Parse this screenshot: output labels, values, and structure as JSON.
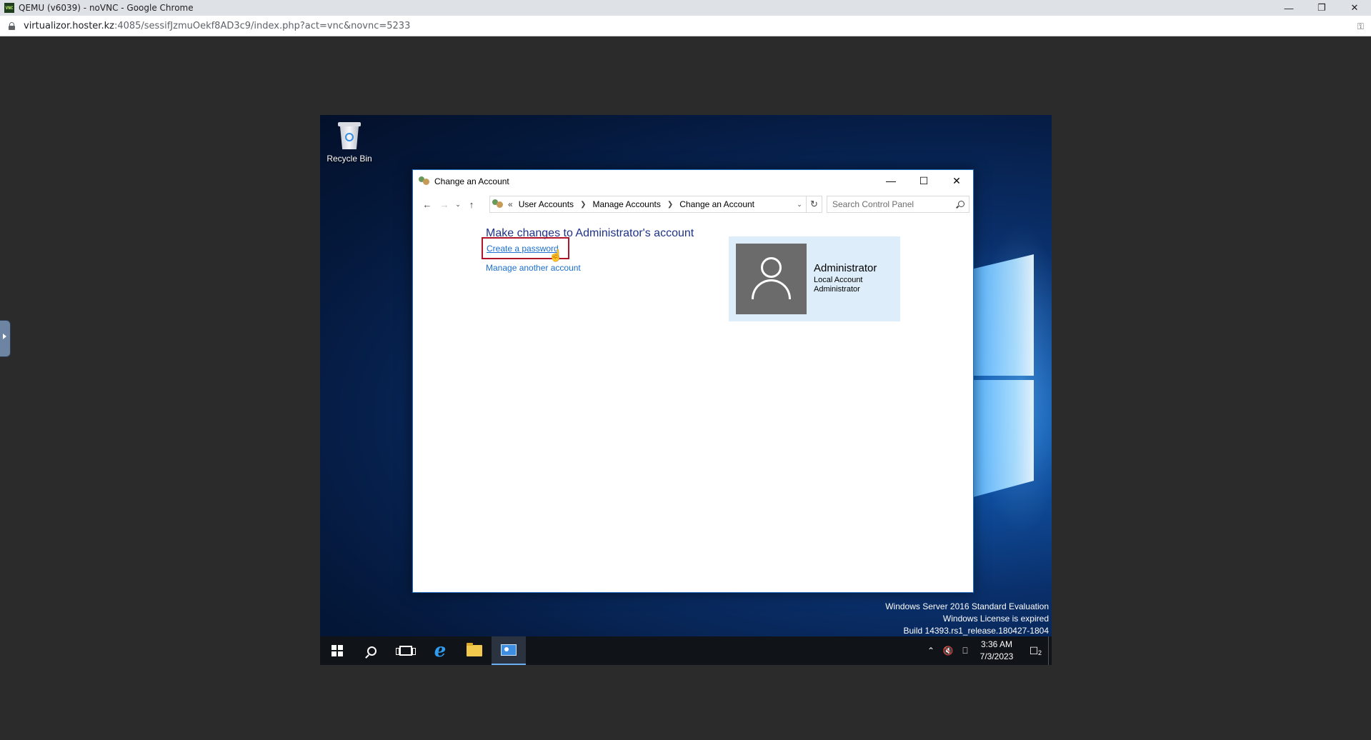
{
  "browser": {
    "title": "QEMU (v6039) - noVNC - Google Chrome",
    "favicon_text": "VNC",
    "url_host": "virtualizor.hoster.kz",
    "url_rest": ":4085/sessifJzmuOekf8AD3c9/index.php?act=vnc&novnc=5233"
  },
  "desktop": {
    "recycle_bin_label": "Recycle Bin",
    "watermark": {
      "line1": "Windows Server 2016 Standard Evaluation",
      "line2": "Windows License is expired",
      "line3": "Build 14393.rs1_release.180427-1804"
    }
  },
  "taskbar": {
    "clock_time": "3:36 AM",
    "clock_date": "7/3/2023",
    "notification_count": "2"
  },
  "window": {
    "title": "Change an Account",
    "breadcrumb": {
      "overflow": "«",
      "items": [
        "User Accounts",
        "Manage Accounts",
        "Change an Account"
      ]
    },
    "search_placeholder": "Search Control Panel",
    "heading": "Make changes to Administrator's account",
    "links": {
      "create_password": "Create a password",
      "manage_another": "Manage another account"
    },
    "account": {
      "name": "Administrator",
      "type": "Local Account",
      "role": "Administrator"
    }
  },
  "colors": {
    "heading": "#1e3287",
    "link": "#1a6fd0",
    "highlight_box": "#b0152a",
    "card_bg": "#ddeefa"
  }
}
